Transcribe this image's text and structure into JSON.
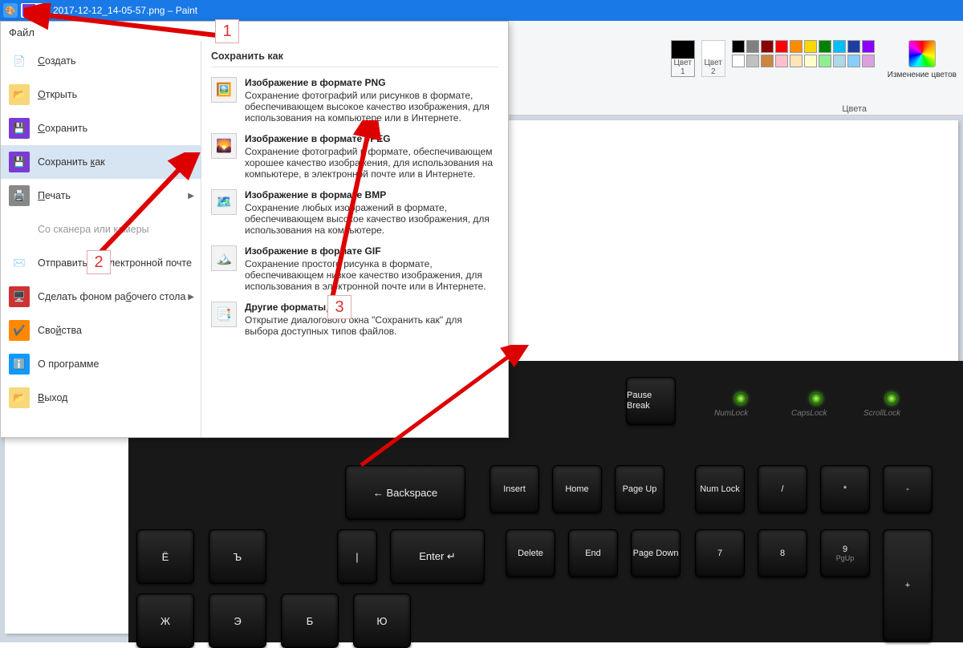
{
  "titlebar": {
    "filename": "2017-12-12_14-05-57.png – Paint"
  },
  "file_tab": "Файл",
  "ribbon": {
    "color1_label": "Цвет 1",
    "color2_label": "Цвет 2",
    "colors_section": "Цвета",
    "edit_colors": "Изменение цветов",
    "palette_row1": [
      "#000000",
      "#808080",
      "#8b0000",
      "#ff0000",
      "#ff8c00",
      "#ffd700",
      "#008000",
      "#00bfff",
      "#1e3fa0",
      "#8b00ff"
    ],
    "palette_row2": [
      "#ffffff",
      "#c0c0c0",
      "#cd853f",
      "#ffc0cb",
      "#ffe4b5",
      "#ffffcc",
      "#90ee90",
      "#add8e6",
      "#87cefa",
      "#dda0dd"
    ]
  },
  "file_menu": {
    "items": [
      {
        "label": "Создать",
        "underline": "С"
      },
      {
        "label": "Открыть",
        "underline": "О"
      },
      {
        "label": "Сохранить",
        "underline": "С"
      },
      {
        "label": "Сохранить как",
        "underline": "к",
        "arrow": true,
        "highlight": true
      },
      {
        "label": "Печать",
        "underline": "П",
        "arrow": true
      },
      {
        "label": "Со сканера или камеры",
        "light": true
      },
      {
        "label": "Отправить по электронной почте"
      },
      {
        "label": "Сделать фоном рабочего стола",
        "underline": "б",
        "arrow": true
      },
      {
        "label": "Свойства",
        "underline": "й"
      },
      {
        "label": "О программе"
      },
      {
        "label": "Выход",
        "underline": "В"
      }
    ]
  },
  "save_as_panel": {
    "header": "Сохранить как",
    "formats": [
      {
        "title": "Изображение в формате PNG",
        "desc": "Сохранение фотографий или рисунков в формате, обеспечивающем высокое качество изображения, для использования на компьютере или в Интернете."
      },
      {
        "title": "Изображение в формате JPEG",
        "desc": "Сохранение фотографий в формате, обеспечивающем хорошее качество изображения, для использования на компьютере, в электронной почте или в Интернете."
      },
      {
        "title": "Изображение в формате BMP",
        "desc": "Сохранение любых изображений в формате, обеспечивающем высокое качество изображения, для использования на компьютере."
      },
      {
        "title": "Изображение в формате GIF",
        "desc": "Сохранение простого рисунка в формате, обеспечивающем низкое качество изображения, для использования в электронной почте или в Интернете."
      },
      {
        "title": "Другие форматы",
        "desc": "Открытие диалогового окна \"Сохранить как\" для выбора доступных типов файлов."
      }
    ]
  },
  "keyboard": {
    "fn": [
      "Pause Break"
    ],
    "row1": [
      "← Backspace",
      "Insert",
      "Home",
      "Page Up",
      "Num Lock",
      "/",
      "*",
      "-"
    ],
    "row2": [
      "|",
      "Enter ↵",
      "Delete",
      "End",
      "Page Down",
      "7",
      "8",
      "9",
      "+"
    ],
    "row3_cyr": [
      "Ё",
      "Ъ",
      "Ж",
      "Э",
      "Б",
      "Ю"
    ],
    "pgup_sub": "PgUp",
    "leds": [
      "NumLock",
      "CapsLock",
      "ScrollLock"
    ]
  },
  "annotations": {
    "a1": "1",
    "a2": "2",
    "a3": "3"
  }
}
